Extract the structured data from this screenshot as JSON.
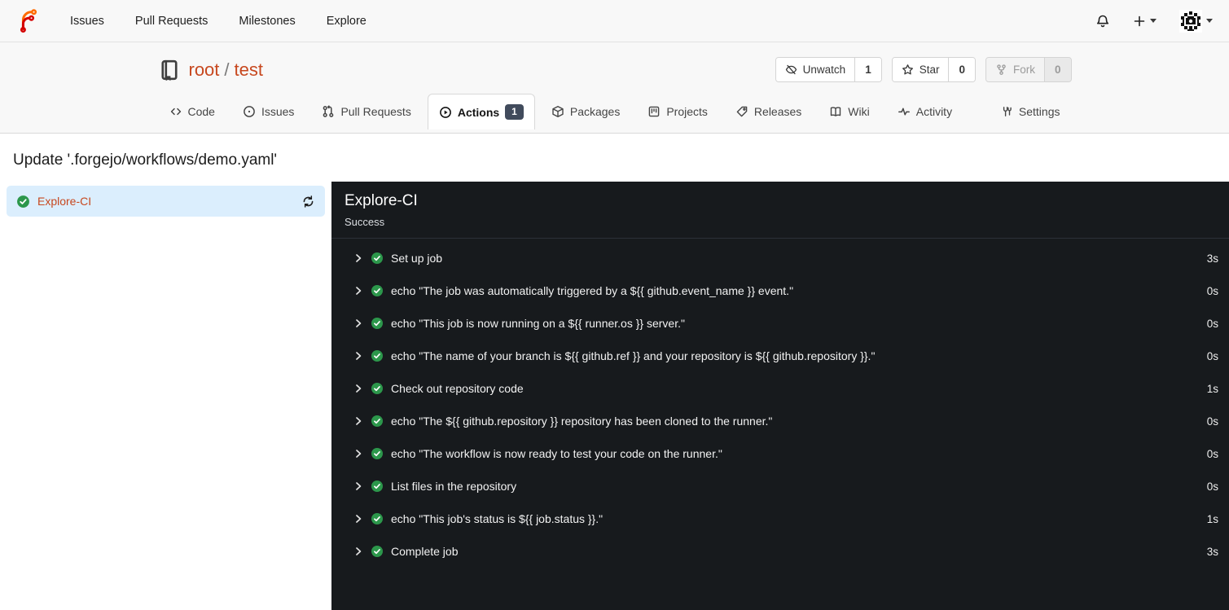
{
  "navbar": {
    "links": [
      {
        "label": "Issues"
      },
      {
        "label": "Pull Requests"
      },
      {
        "label": "Milestones"
      },
      {
        "label": "Explore"
      }
    ],
    "icons": [
      "forgejo-logo",
      "bell-icon",
      "plus-icon",
      "caret-down-icon",
      "avatar-identicon"
    ]
  },
  "repo_header": {
    "owner": "root",
    "separator": "/",
    "name": "test",
    "icon": "repo-book-icon",
    "buttons": [
      {
        "label": "Unwatch",
        "count": "1",
        "icon": "eye-slash-icon",
        "disabled": false
      },
      {
        "label": "Star",
        "count": "0",
        "icon": "star-icon",
        "disabled": false
      },
      {
        "label": "Fork",
        "count": "0",
        "icon": "fork-icon",
        "disabled": true
      }
    ]
  },
  "tabs": [
    {
      "label": "Code",
      "icon": "code-icon",
      "active": false
    },
    {
      "label": "Issues",
      "icon": "issue-icon",
      "active": false
    },
    {
      "label": "Pull Requests",
      "icon": "pull-request-icon",
      "active": false
    },
    {
      "label": "Actions",
      "icon": "play-circle-icon",
      "active": true,
      "badge": "1"
    },
    {
      "label": "Packages",
      "icon": "package-icon",
      "active": false
    },
    {
      "label": "Projects",
      "icon": "project-icon",
      "active": false
    },
    {
      "label": "Releases",
      "icon": "tag-icon",
      "active": false
    },
    {
      "label": "Wiki",
      "icon": "book-open-icon",
      "active": false
    },
    {
      "label": "Activity",
      "icon": "activity-icon",
      "active": false
    }
  ],
  "settings_tab": {
    "label": "Settings",
    "icon": "tools-icon"
  },
  "run": {
    "title": "Update '.forgejo/workflows/demo.yaml'",
    "job": {
      "name": "Explore-CI",
      "status": "Success",
      "status_icon": "check-circle-icon"
    },
    "steps": [
      {
        "name": "Set up job",
        "duration": "3s"
      },
      {
        "name": "echo \"The job was automatically triggered by a ${{ github.event_name }} event.\"",
        "duration": "0s"
      },
      {
        "name": "echo \"This job is now running on a ${{ runner.os }} server.\"",
        "duration": "0s"
      },
      {
        "name": "echo \"The name of your branch is ${{ github.ref }} and your repository is ${{ github.repository }}.\"",
        "duration": "0s"
      },
      {
        "name": "Check out repository code",
        "duration": "1s"
      },
      {
        "name": "echo \"The ${{ github.repository }} repository has been cloned to the runner.\"",
        "duration": "0s"
      },
      {
        "name": "echo \"The workflow is now ready to test your code on the runner.\"",
        "duration": "0s"
      },
      {
        "name": "List files in the repository",
        "duration": "0s"
      },
      {
        "name": "echo \"This job's status is ${{ job.status }}.\"",
        "duration": "1s"
      },
      {
        "name": "Complete job",
        "duration": "3s"
      }
    ]
  },
  "colors": {
    "link_accent": "#c7481f",
    "success_green": "#2c974b",
    "header_bg": "#f8f8f8",
    "panel_bg": "#171a1d",
    "selected_job_bg": "#dbeefd",
    "badge_bg": "#414b5c",
    "logo_orange": "#ff6b00",
    "logo_red": "#d40000"
  }
}
